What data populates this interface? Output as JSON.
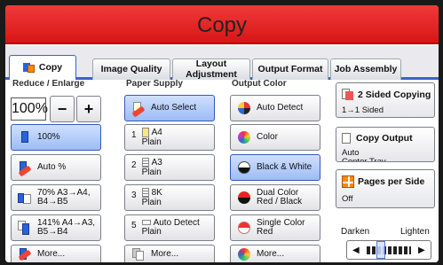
{
  "window": {
    "title": "Copy"
  },
  "tabs": [
    {
      "label": "Copy",
      "active": true
    },
    {
      "label": "Image Quality",
      "active": false
    },
    {
      "label": "Layout Adjustment",
      "active": false
    },
    {
      "label": "Output Format",
      "active": false
    },
    {
      "label": "Job Assembly",
      "active": false
    }
  ],
  "reduce": {
    "header": "Reduce / Enlarge",
    "ratio": "100%",
    "minus": "−",
    "plus": "+",
    "options": [
      {
        "label": "100%",
        "selected": true
      },
      {
        "label": "Auto %",
        "selected": false
      },
      {
        "label": "70% A3→A4,\nB4→B5",
        "selected": false
      },
      {
        "label": "141% A4→A3,\nB5→B4",
        "selected": false
      },
      {
        "label": "More...",
        "selected": false
      }
    ]
  },
  "paper": {
    "header": "Paper Supply",
    "options": [
      {
        "label": "Auto Select",
        "selected": true
      },
      {
        "num": "1",
        "size": "A4",
        "type": "Plain",
        "selected": false
      },
      {
        "num": "2",
        "size": "A3",
        "type": "Plain",
        "selected": false
      },
      {
        "num": "3",
        "size": "8K",
        "type": "Plain",
        "selected": false
      },
      {
        "num": "5",
        "size": "Auto Detect",
        "type": "Plain",
        "selected": false
      },
      {
        "label": "More...",
        "selected": false
      }
    ]
  },
  "color": {
    "header": "Output Color",
    "options": [
      {
        "label": "Auto Detect",
        "selected": false
      },
      {
        "label": "Color",
        "selected": false
      },
      {
        "label": "Black & White",
        "selected": true
      },
      {
        "label": "Dual Color\nRed / Black",
        "selected": false
      },
      {
        "label": "Single Color\nRed",
        "selected": false
      },
      {
        "label": "More...",
        "selected": false
      }
    ]
  },
  "right": {
    "two_sided": {
      "title": "2 Sided Copying",
      "value": "1→1 Sided"
    },
    "copy_output": {
      "title": "Copy Output",
      "value": "Auto\nCenter Tray"
    },
    "pages_per_side": {
      "title": "Pages per Side",
      "value": "Off"
    },
    "darken_label": "Darken",
    "lighten_label": "Lighten",
    "left_arrow": "◀",
    "right_arrow": "▶",
    "density_level": 3
  }
}
